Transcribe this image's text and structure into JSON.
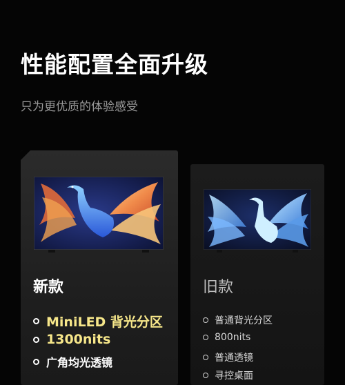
{
  "header": {
    "title": "性能配置全面升级",
    "subtitle": "只为更优质的体验感受"
  },
  "new_model": {
    "label": "新款",
    "features": [
      "MiniLED 背光分区",
      "1300nits",
      "广角均光透镜"
    ]
  },
  "old_model": {
    "label": "旧款",
    "features": [
      "普通背光分区",
      "800nits",
      "普通透镜",
      "寻控桌面"
    ]
  },
  "colors": {
    "background": "#050505",
    "highlight_text": "#f7e78a",
    "card_new": "#262626",
    "card_old": "#171717"
  }
}
